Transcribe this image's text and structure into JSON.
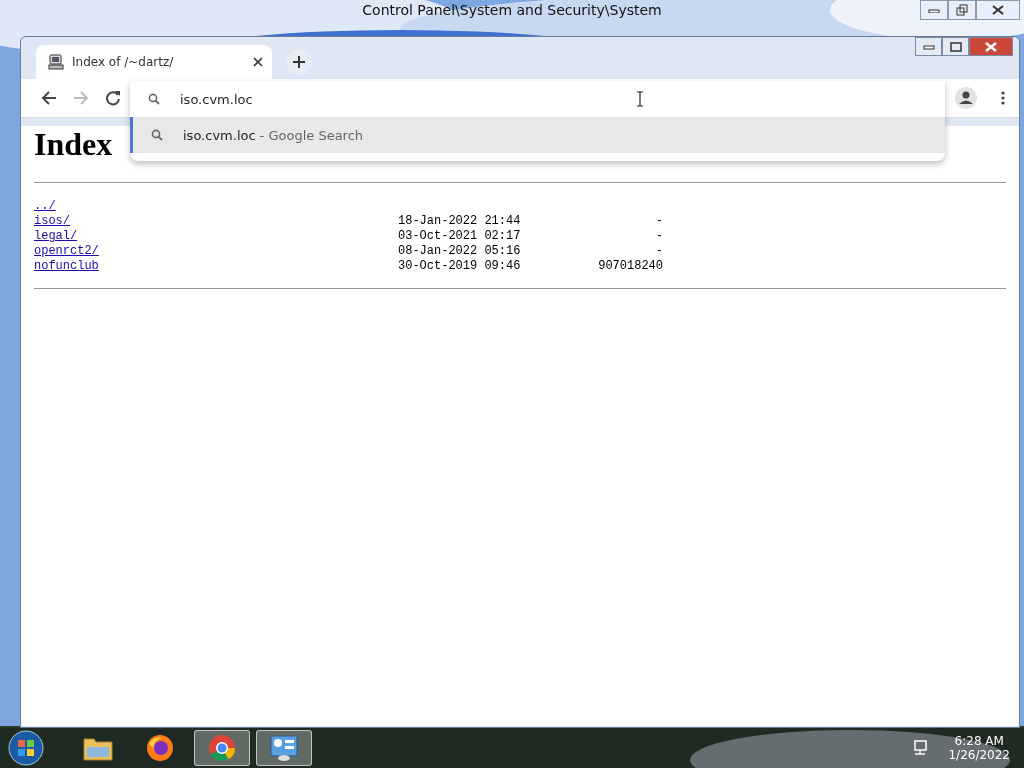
{
  "back_window": {
    "title": "Control Panel\\System and Security\\System"
  },
  "browser": {
    "tabs": [
      {
        "title": "Index of /~dartz/",
        "selected": true
      }
    ],
    "nav": {
      "forward_disabled": true
    },
    "omnibox": {
      "value": "iso.cvm.loc",
      "suggestions": [
        {
          "text": "iso.cvm.loc",
          "hint": "- Google Search",
          "selected": true
        }
      ]
    },
    "page": {
      "heading": "Index",
      "entries": [
        {
          "name": "../"
        },
        {
          "name": "isos/",
          "date": "18-Jan-2022 21:44",
          "size": "-"
        },
        {
          "name": "legal/",
          "date": "03-Oct-2021 02:17",
          "size": "-"
        },
        {
          "name": "openrct2/",
          "date": "08-Jan-2022 05:16",
          "size": "-"
        },
        {
          "name": "nofunclub",
          "date": "30-Oct-2019 09:46",
          "size": "907018240"
        }
      ]
    }
  },
  "taskbar": {
    "apps": [
      {
        "kind": "explorer",
        "active": false
      },
      {
        "kind": "firefox",
        "active": false
      },
      {
        "kind": "chrome",
        "active": true
      },
      {
        "kind": "control-panel",
        "active": true
      }
    ],
    "time": "6:28 AM",
    "date": "1/26/2022"
  }
}
